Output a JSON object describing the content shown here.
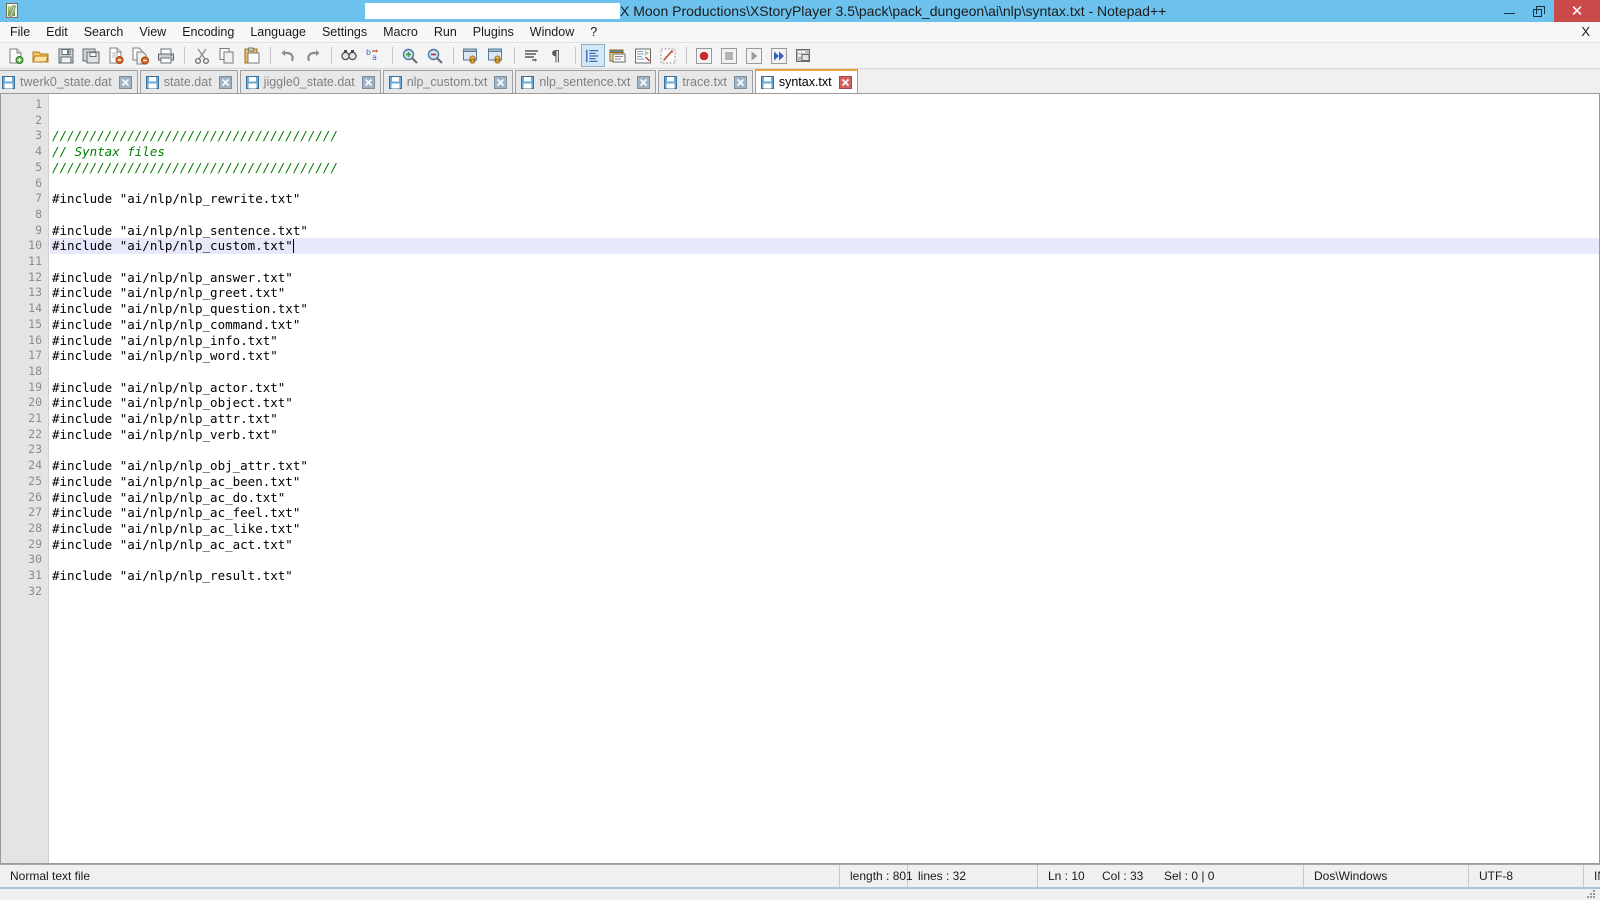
{
  "window": {
    "title_visible": "X Moon Productions\\XStoryPlayer 3.5\\pack\\pack_dungeon\\ai\\nlp\\syntax.txt - Notepad++",
    "app_icon": "notepad-plus-plus-icon",
    "minimize_label": "–",
    "maximize_label": "❐",
    "close_label": "✕"
  },
  "menu": {
    "items": [
      {
        "label": "File"
      },
      {
        "label": "Edit"
      },
      {
        "label": "Search"
      },
      {
        "label": "View"
      },
      {
        "label": "Encoding"
      },
      {
        "label": "Language"
      },
      {
        "label": "Settings"
      },
      {
        "label": "Macro"
      },
      {
        "label": "Run"
      },
      {
        "label": "Plugins"
      },
      {
        "label": "Window"
      },
      {
        "label": "?"
      }
    ],
    "close_document_label": "X"
  },
  "toolbar": {
    "buttons": [
      {
        "name": "new-file-icon",
        "title": "New"
      },
      {
        "name": "open-file-icon",
        "title": "Open"
      },
      {
        "name": "save-icon",
        "title": "Save"
      },
      {
        "name": "save-all-icon",
        "title": "Save All"
      },
      {
        "name": "close-file-icon",
        "title": "Close"
      },
      {
        "name": "close-all-files-icon",
        "title": "Close All"
      },
      {
        "name": "print-icon",
        "title": "Print"
      },
      {
        "name": "separator",
        "title": ""
      },
      {
        "name": "cut-icon",
        "title": "Cut"
      },
      {
        "name": "copy-icon",
        "title": "Copy"
      },
      {
        "name": "paste-icon",
        "title": "Paste"
      },
      {
        "name": "separator",
        "title": ""
      },
      {
        "name": "undo-icon",
        "title": "Undo"
      },
      {
        "name": "redo-icon",
        "title": "Redo"
      },
      {
        "name": "separator",
        "title": ""
      },
      {
        "name": "find-icon",
        "title": "Find"
      },
      {
        "name": "replace-icon",
        "title": "Replace"
      },
      {
        "name": "separator",
        "title": ""
      },
      {
        "name": "zoom-in-icon",
        "title": "Zoom In"
      },
      {
        "name": "zoom-out-icon",
        "title": "Zoom Out"
      },
      {
        "name": "separator",
        "title": ""
      },
      {
        "name": "sync-vertical-scroll-icon",
        "title": "Synchronize Vertical Scrolling"
      },
      {
        "name": "sync-horizontal-scroll-icon",
        "title": "Synchronize Horizontal Scrolling"
      },
      {
        "name": "separator",
        "title": ""
      },
      {
        "name": "word-wrap-icon",
        "title": "Word Wrap"
      },
      {
        "name": "show-all-characters-icon",
        "title": "Show All Characters"
      },
      {
        "name": "separator",
        "title": ""
      },
      {
        "name": "indent-guide-icon",
        "title": "Show Indent Guide"
      },
      {
        "name": "user-defined-dialog-icon",
        "title": "UserDefine Dialogue"
      },
      {
        "name": "document-map-icon",
        "title": "Document Map"
      },
      {
        "name": "function-list-icon",
        "title": "Function List"
      },
      {
        "name": "separator",
        "title": ""
      },
      {
        "name": "record-macro-icon",
        "title": "Start Recording"
      },
      {
        "name": "stop-macro-icon",
        "title": "Stop Recording"
      },
      {
        "name": "play-macro-icon",
        "title": "Playback"
      },
      {
        "name": "run-macro-multiple-icon",
        "title": "Run a Macro Multiple Times"
      },
      {
        "name": "save-macro-icon",
        "title": "Save Current Recorded Macro"
      }
    ]
  },
  "tabs": {
    "items": [
      {
        "label": "twerk0_state.dat",
        "active": false
      },
      {
        "label": "state.dat",
        "active": false
      },
      {
        "label": "jiggle0_state.dat",
        "active": false
      },
      {
        "label": "nlp_custom.txt",
        "active": false
      },
      {
        "label": "nlp_sentence.txt",
        "active": false
      },
      {
        "label": "trace.txt",
        "active": false
      },
      {
        "label": "syntax.txt",
        "active": true
      }
    ],
    "close_glyph": "✕",
    "active_accent_color": "#e8a33d"
  },
  "editor": {
    "current_line": 10,
    "current_line_highlight_color": "#e8e8fb",
    "lines": [
      {
        "n": 1,
        "text": ""
      },
      {
        "n": 2,
        "text": ""
      },
      {
        "n": 3,
        "text": "//////////////////////////////////////"
      },
      {
        "n": 4,
        "text": "// Syntax files"
      },
      {
        "n": 5,
        "text": "//////////////////////////////////////"
      },
      {
        "n": 6,
        "text": ""
      },
      {
        "n": 7,
        "text": "#include \"ai/nlp/nlp_rewrite.txt\""
      },
      {
        "n": 8,
        "text": ""
      },
      {
        "n": 9,
        "text": "#include \"ai/nlp/nlp_sentence.txt\""
      },
      {
        "n": 10,
        "text": "#include \"ai/nlp/nlp_custom.txt\""
      },
      {
        "n": 11,
        "text": ""
      },
      {
        "n": 12,
        "text": "#include \"ai/nlp/nlp_answer.txt\""
      },
      {
        "n": 13,
        "text": "#include \"ai/nlp/nlp_greet.txt\""
      },
      {
        "n": 14,
        "text": "#include \"ai/nlp/nlp_question.txt\""
      },
      {
        "n": 15,
        "text": "#include \"ai/nlp/nlp_command.txt\""
      },
      {
        "n": 16,
        "text": "#include \"ai/nlp/nlp_info.txt\""
      },
      {
        "n": 17,
        "text": "#include \"ai/nlp/nlp_word.txt\""
      },
      {
        "n": 18,
        "text": ""
      },
      {
        "n": 19,
        "text": "#include \"ai/nlp/nlp_actor.txt\""
      },
      {
        "n": 20,
        "text": "#include \"ai/nlp/nlp_object.txt\""
      },
      {
        "n": 21,
        "text": "#include \"ai/nlp/nlp_attr.txt\""
      },
      {
        "n": 22,
        "text": "#include \"ai/nlp/nlp_verb.txt\""
      },
      {
        "n": 23,
        "text": ""
      },
      {
        "n": 24,
        "text": "#include \"ai/nlp/nlp_obj_attr.txt\""
      },
      {
        "n": 25,
        "text": "#include \"ai/nlp/nlp_ac_been.txt\""
      },
      {
        "n": 26,
        "text": "#include \"ai/nlp/nlp_ac_do.txt\""
      },
      {
        "n": 27,
        "text": "#include \"ai/nlp/nlp_ac_feel.txt\""
      },
      {
        "n": 28,
        "text": "#include \"ai/nlp/nlp_ac_like.txt\""
      },
      {
        "n": 29,
        "text": "#include \"ai/nlp/nlp_ac_act.txt\""
      },
      {
        "n": 30,
        "text": ""
      },
      {
        "n": 31,
        "text": "#include \"ai/nlp/nlp_result.txt\""
      },
      {
        "n": 32,
        "text": ""
      }
    ]
  },
  "statusbar": {
    "file_type": "Normal text file",
    "length": "length : 801",
    "lines": "lines : 32",
    "ln": "Ln : 10",
    "col": "Col : 33",
    "sel": "Sel : 0 | 0",
    "eol": "Dos\\Windows",
    "encoding": "UTF-8",
    "insert_mode": "INS"
  }
}
